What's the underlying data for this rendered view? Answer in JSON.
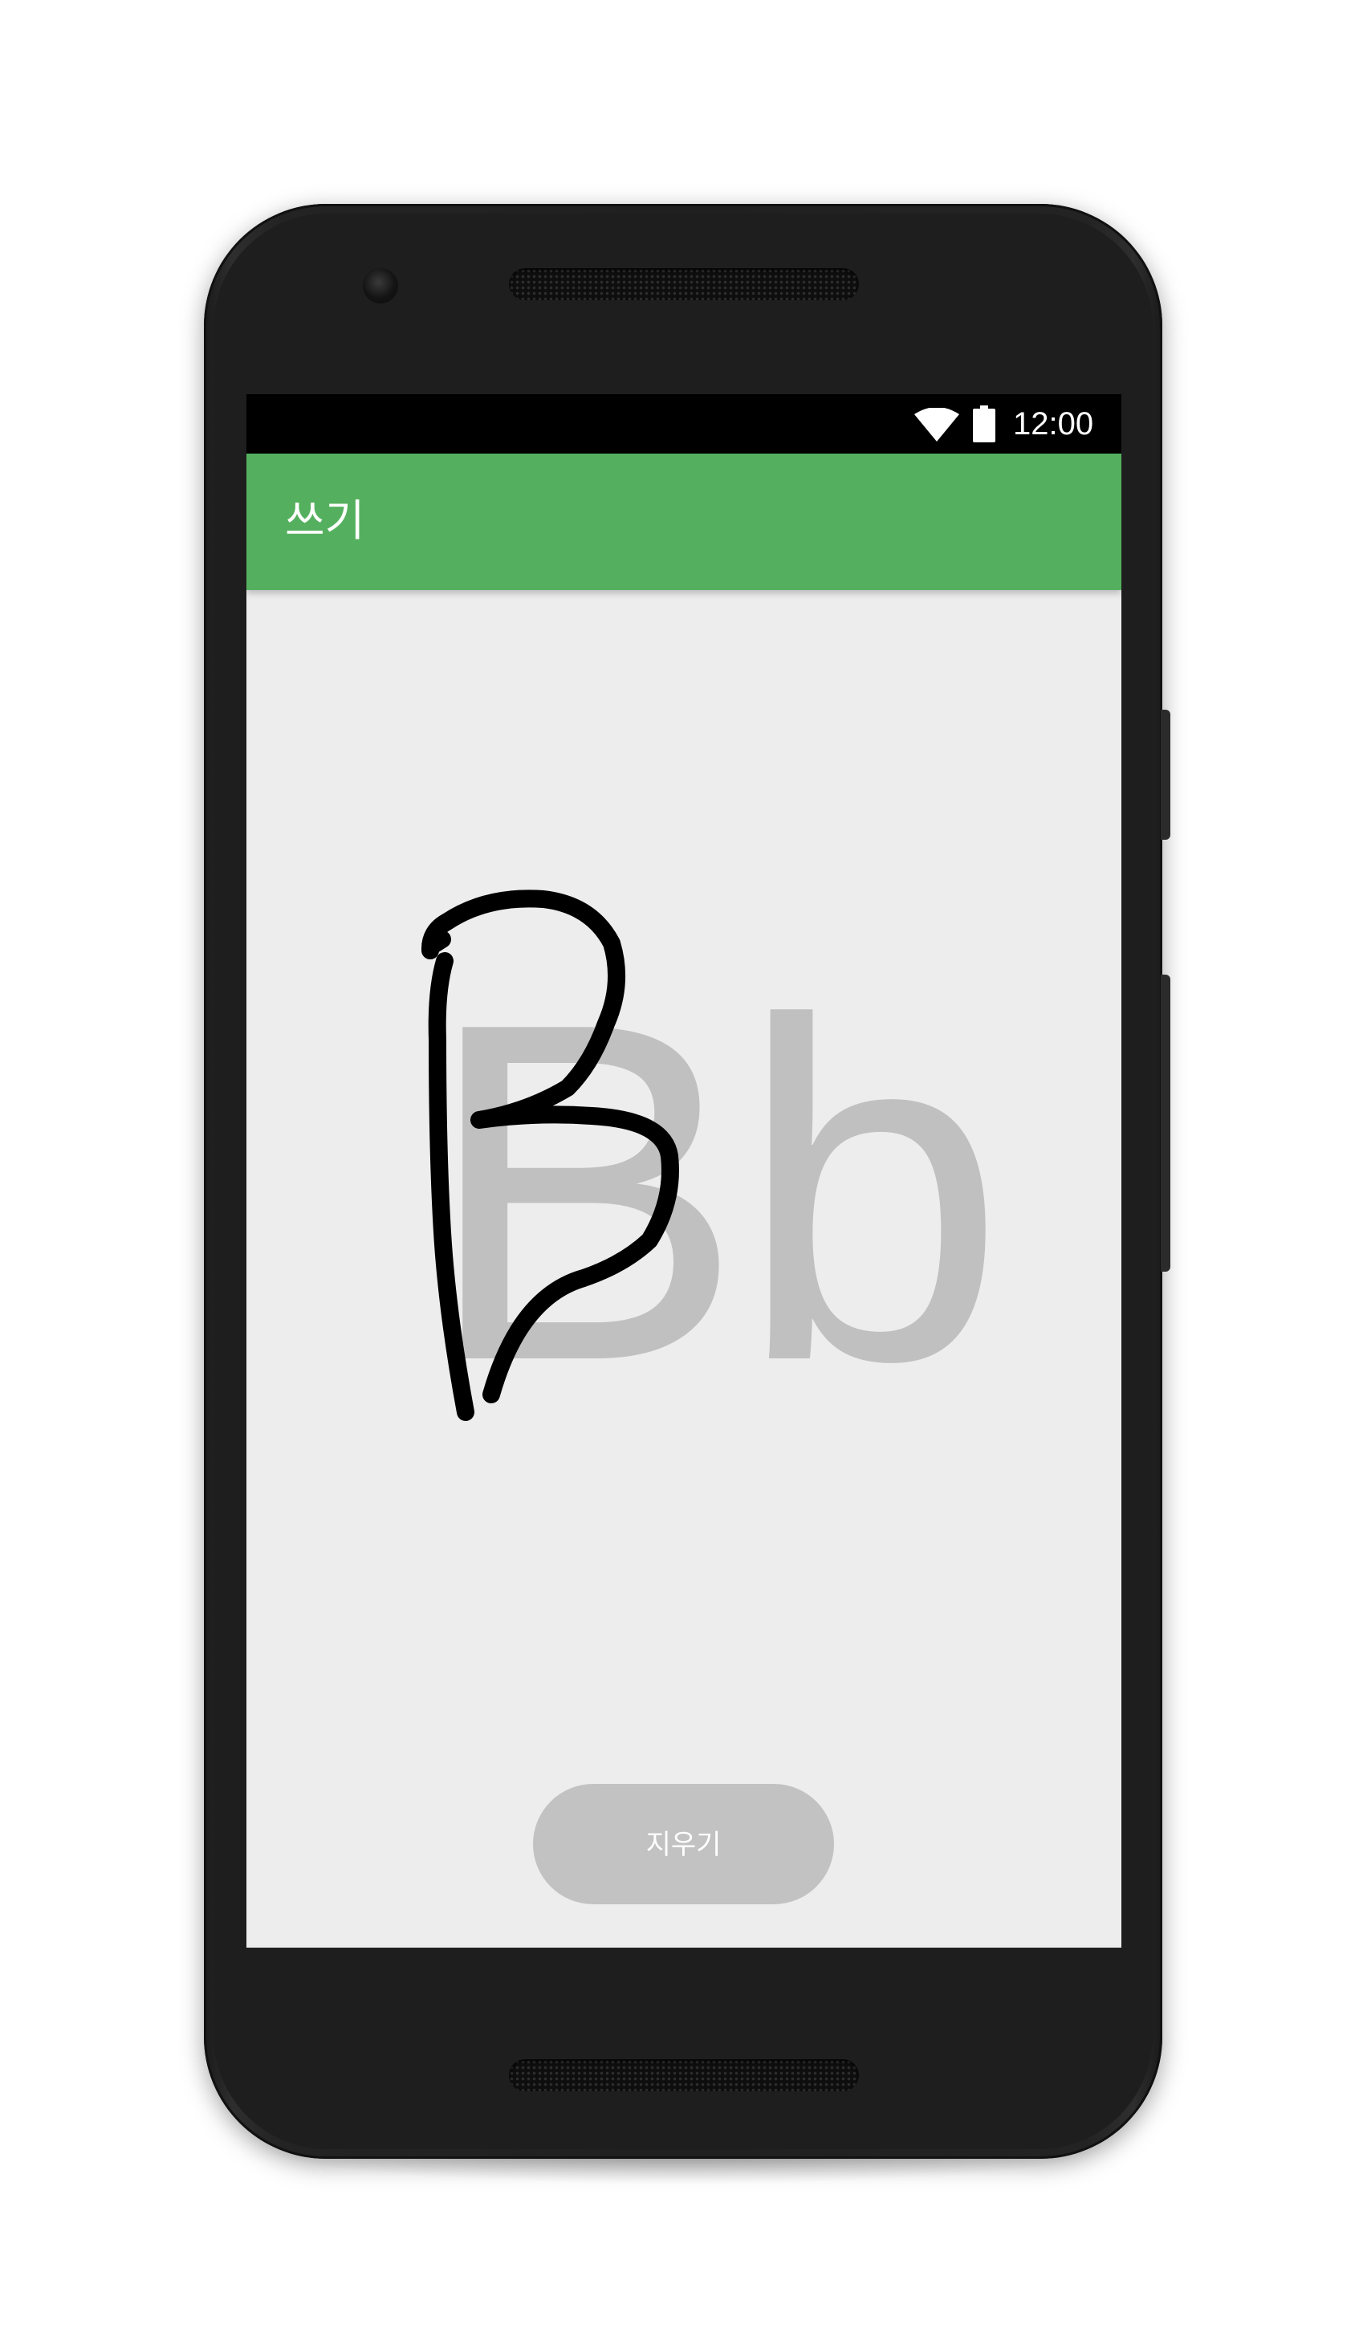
{
  "status_bar": {
    "time": "12:00",
    "wifi_icon": "wifi-icon",
    "battery_icon": "battery-icon"
  },
  "app_bar": {
    "title": "쓰기",
    "color": "#54b05e"
  },
  "canvas": {
    "guide_text": "Bb",
    "guide_color": "#c0c0c0",
    "stroke_color": "#000000",
    "background": "#ededed"
  },
  "actions": {
    "clear_label": "지우기"
  }
}
